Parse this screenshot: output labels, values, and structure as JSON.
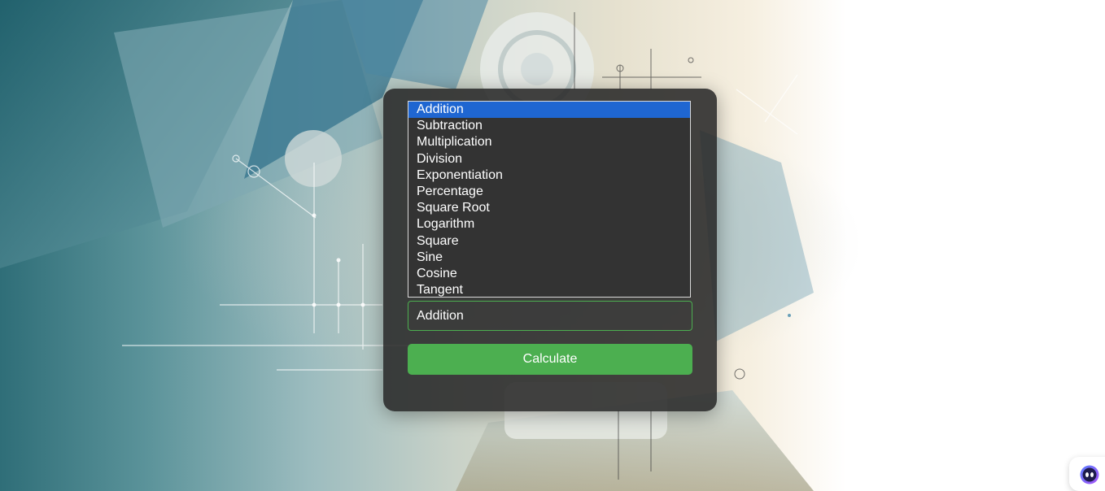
{
  "operations": {
    "options": [
      "Addition",
      "Subtraction",
      "Multiplication",
      "Division",
      "Exponentiation",
      "Percentage",
      "Square Root",
      "Logarithm",
      "Square",
      "Sine",
      "Cosine",
      "Tangent"
    ],
    "highlighted": "Addition",
    "selected_value": "Addition"
  },
  "calculate_label": "Calculate",
  "colors": {
    "button": "#4caf50",
    "highlight": "#1f66d1",
    "card": "#242424"
  },
  "icons": {
    "assistant": "chat-assistant-icon"
  }
}
